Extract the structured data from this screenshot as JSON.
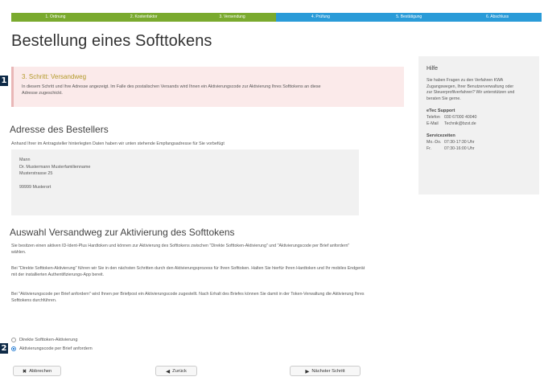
{
  "steps": [
    {
      "label": "1. Ordnung",
      "state": "done"
    },
    {
      "label": "2. Kostenfaktor",
      "state": "done"
    },
    {
      "label": "3. Versendung",
      "state": "done"
    },
    {
      "label": "4. Prüfung",
      "state": "todo"
    },
    {
      "label": "5. Bestätigung",
      "state": "todo"
    },
    {
      "label": "6. Abschluss",
      "state": "todo"
    }
  ],
  "title": "Bestellung eines Softtokens",
  "markers": [
    "1",
    "2"
  ],
  "alert": {
    "title": "3. Schritt: Versandweg",
    "text": "In diesem Schritt und Ihre Adresse angezeigt. Im Falle des postalischen Versands wird Ihnen ein Aktivierungscode zur Aktivierung Ihres Softtokens an diese Adresse zugeschickt."
  },
  "address": {
    "heading": "Adresse des Bestellers",
    "intro": "Anhand Ihrer im Antragsteller hinterlegten Daten haben wir unten stehende Empfangsadresse für Sie vorbefügt",
    "lines": [
      "Mann",
      "Dr. Mustermann Musterfamilienname",
      "Musterstrasse 25"
    ],
    "city": "99999 Musterort"
  },
  "shipping": {
    "heading": "Auswahl Versandweg zur Aktivierung des Softtokens",
    "paragraphs": [
      "Sie besitzen einen aktiven ID-Ident-Plus Hardtoken und können zur Aktivierung des Softtokens zwischen \"Direkte Softtoken-Aktivierung\" und \"Aktivierungscode per Brief anfordern\" wählen.",
      "Bei \"Direkte Softtoken-Aktivierung\" führen wir Sie in den nächsten Schritten durch den Aktivierungsprozess für Ihren Softtoken. Halten Sie hierfür Ihren Hardtoken und Ihr mobiles Endgerät mit der installierten Authentifizierungs-App bereit.",
      "Bei \"Aktivierungscode per Brief anfordern\" wird Ihnen per Briefpost ein Aktivierungscode zugestellt. Nach Erhalt des Briefes können Sie damit in der Token-Verwaltung die Aktivierung Ihres Softtokens durchführen."
    ],
    "options": [
      {
        "label": "Direkte Softtoken-Aktivierung",
        "checked": false
      },
      {
        "label": "Aktivierungscode per Brief anfordern",
        "checked": true
      }
    ]
  },
  "buttons": {
    "cancel": "Abbrechen",
    "cancel_icon": "✖",
    "back": "Zurück",
    "back_icon": "◀",
    "next": "Nächster Schritt",
    "next_icon": "▶"
  },
  "help": {
    "title": "Hilfe",
    "text": "Sie haben Fragen zu den Verfahren KWA Zugangswegen, Ihrer Benutzerverwaltung oder zur Steuerprofilverfahren? Wir unterstützen und beraten Sie gerne.",
    "support_title": "eTec Support",
    "support": [
      {
        "k": "Telefon",
        "v": "030 67000 40040"
      },
      {
        "k": "E-Mail",
        "v": "Technik@bzst.de"
      }
    ],
    "hours_title": "Servicezeiten",
    "hours": [
      {
        "k": "Mo.-Do.",
        "v": "07:30-17:30 Uhr"
      },
      {
        "k": "Fr.",
        "v": "07:30-16:00 Uhr"
      }
    ]
  }
}
